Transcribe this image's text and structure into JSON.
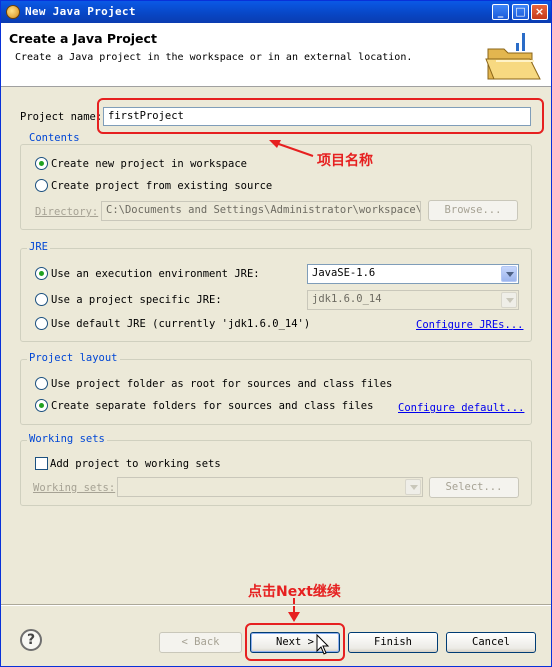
{
  "window": {
    "title": "New Java Project"
  },
  "header": {
    "title": "Create a Java Project",
    "subtitle": "Create a Java project in the workspace or in an external location."
  },
  "project_name": {
    "label": "Project name:",
    "value": "firstProject"
  },
  "contents": {
    "title": "Contents",
    "create_new": "Create new project in workspace",
    "from_existing": "Create project from existing source",
    "directory_label": "Directory:",
    "directory_value": "C:\\Documents and Settings\\Administrator\\workspace\\fir",
    "browse": "Browse...",
    "selected": "create_new"
  },
  "jre": {
    "title": "JRE",
    "use_execution_env": "Use an execution environment JRE:",
    "execution_env_value": "JavaSE-1.6",
    "use_project_specific": "Use a project specific JRE:",
    "project_specific_value": "jdk1.6.0_14",
    "use_default": "Use default JRE (currently 'jdk1.6.0_14')",
    "configure_link": "Configure JREs...",
    "selected": "use_execution_env"
  },
  "layout": {
    "title": "Project layout",
    "root_folder": "Use project folder as root for sources and class files",
    "separate_folders": "Create separate folders for sources and class files",
    "configure_link": "Configure default...",
    "selected": "separate_folders"
  },
  "working_sets": {
    "title": "Working sets",
    "add_checkbox": "Add project to working sets",
    "add_checked": false,
    "sets_label": "Working sets:",
    "sets_value": "",
    "select": "Select..."
  },
  "buttons": {
    "back": "< Back",
    "next": "Next >",
    "finish": "Finish",
    "cancel": "Cancel"
  },
  "annotations": {
    "project_name": "项目名称",
    "click_next": "点击Next继续",
    "color": "#e62020"
  }
}
